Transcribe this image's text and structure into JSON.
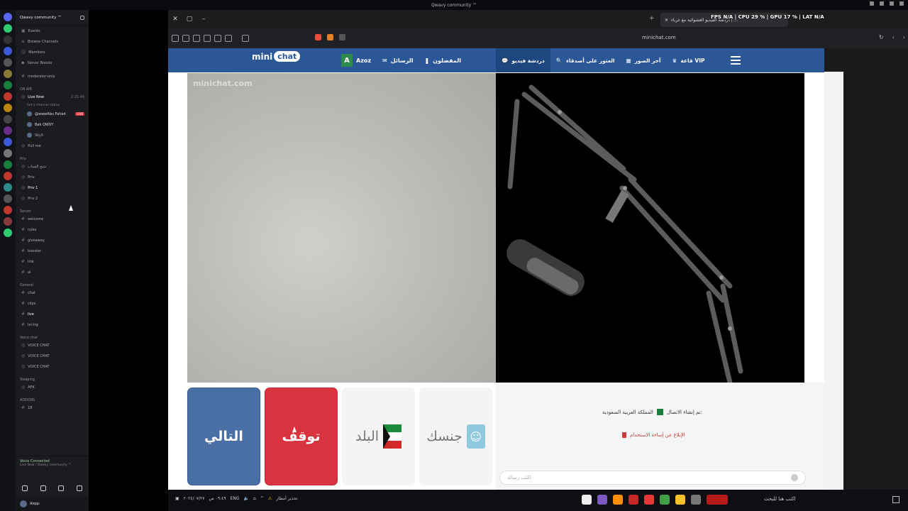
{
  "os_title": "Qwavy community ™",
  "discord": {
    "server_name": "Qwavy community ™",
    "top_items": [
      "Events",
      "Browse Channels",
      "Members",
      "Server Boosts"
    ],
    "moderator_channel": "moderator-only",
    "categories": [
      {
        "name": "ON AIR",
        "rows": [
          "Live Now",
          "Set a channel status",
          "@wwwAbu Fahad",
          "Bak QWVY",
          "Sky0",
          "Pull me"
        ]
      },
      {
        "name": "Priv",
        "rows": [
          "شيخ الشباب",
          "Priv",
          "Priv 1",
          "Priv 2"
        ]
      },
      {
        "name": "Server",
        "rows": [
          "welcome",
          "rules",
          "giveaway",
          "booster",
          "link",
          "ai"
        ]
      },
      {
        "name": "General",
        "rows": [
          "chat",
          "clips",
          "live",
          "lol-trg"
        ]
      },
      {
        "name": "Voice chat",
        "rows": [
          "VOICE CHAT",
          "VOICE CHAT",
          "VOICE CHAT"
        ]
      },
      {
        "name": "Sleeping",
        "rows": [
          "AFK"
        ]
      },
      {
        "name": "ADDONS",
        "rows": [
          "18"
        ]
      }
    ],
    "live_badge": "LIVE",
    "live_time": "2:15:46",
    "voice_connected": "Voice Connected",
    "voice_sub": "Live Now / Qwavy community ™",
    "username": "Alqqs"
  },
  "browser": {
    "tab_title": "دردشة الفيديو العشوائية مع غرباء | ...",
    "stats_text": "FPS N/A | CPU 29 % | GPU 17 % | LAT N/A",
    "url": "minichat.com"
  },
  "site": {
    "logo_text": "mini",
    "logo_chat": "chat",
    "user_initial": "A",
    "user_name": "Azoz",
    "nav_messages": "الرسائل",
    "nav_favorites": "المفضلون",
    "nav_video_chat": "دردشة فيديو",
    "nav_search_friends": "العثور على أصدقاء",
    "nav_photos": "آخر الصور",
    "nav_vip": "قاعة VIP",
    "watermark": "minichat.com",
    "btn_next": "التالي",
    "btn_stop": "توقف",
    "btn_country": "البلد",
    "btn_gender": "جنسك",
    "connection_msg": "تم إنشاء الاتصال:",
    "connection_country": "المملكة العربية السعودية",
    "report_text": "الإبلاغ عن إساءة الاستخدام",
    "message_placeholder": "اكتب رسالة"
  },
  "taskbar": {
    "lang": "ENG",
    "weather": "تحذير أمطار",
    "search": "اكتب هنا للبحث",
    "time": "٠٩:٤٩ ص",
    "date": "٢٠٢٤/٠٧/٢٧"
  },
  "colors": {
    "site_blue": "#2b5797",
    "next_blue": "#4a6fa5",
    "stop_red": "#d93340"
  }
}
